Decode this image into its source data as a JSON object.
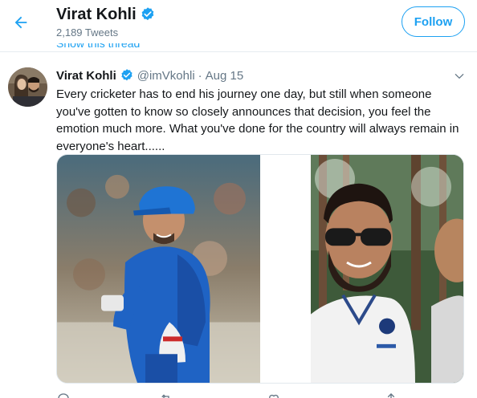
{
  "header": {
    "name": "Virat Kohli",
    "tweets_count": "2,189 Tweets",
    "follow_label": "Follow"
  },
  "thread": {
    "show_thread_label": "Show this thread"
  },
  "tweet": {
    "author_name": "Virat Kohli",
    "handle": "@imVkohli",
    "separator": "·",
    "date": "Aug 15",
    "text": "Every cricketer has to end his journey one day, but still when someone you've gotten to know so closely announces that decision, you feel the emotion much more. What you've done for the country will always remain in everyone's heart......"
  },
  "colors": {
    "accent": "#1da1f2",
    "secondary_text": "#657786",
    "primary_text": "#14171a",
    "divider": "#e6ecf0"
  },
  "icons": [
    "back-arrow-icon",
    "verified-badge-icon",
    "caret-down-icon",
    "reply-icon",
    "retweet-icon",
    "like-icon",
    "share-icon"
  ]
}
